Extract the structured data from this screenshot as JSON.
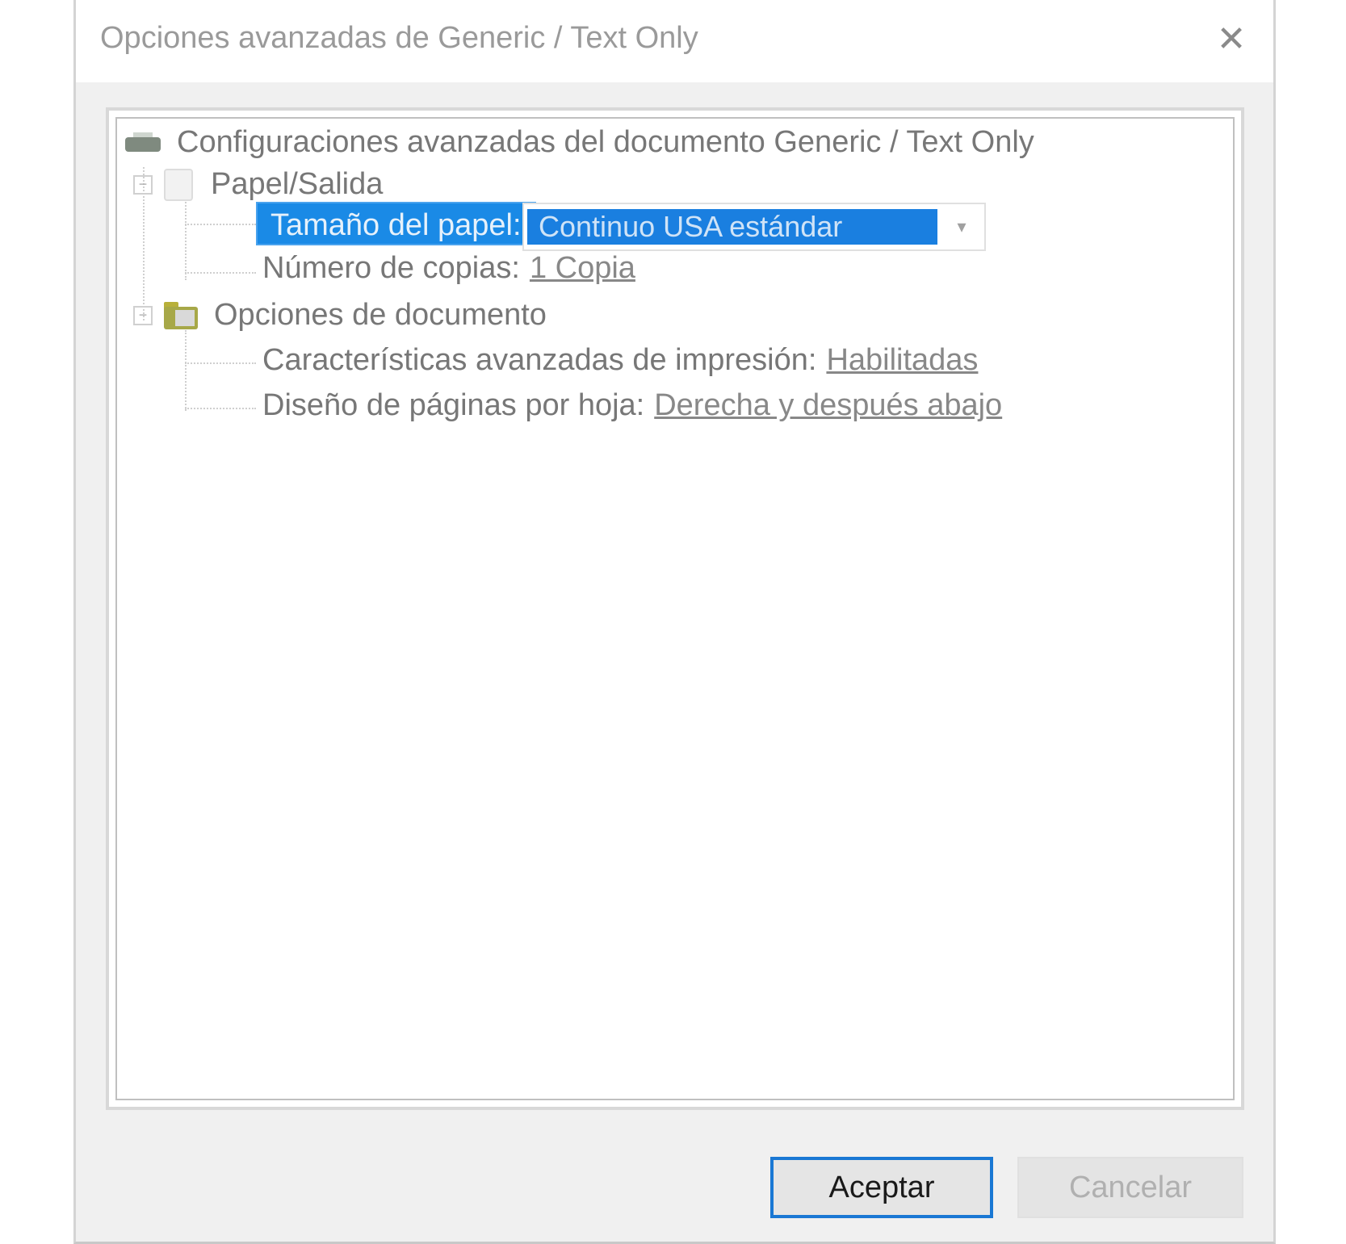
{
  "window": {
    "title": "Opciones avanzadas de Generic / Text Only",
    "close_glyph": "✕"
  },
  "tree": {
    "root_label": "Configuraciones avanzadas del documento Generic / Text Only",
    "paper_output": {
      "label": "Papel/Salida",
      "expander": "−",
      "paper_size": {
        "label": "Tamaño del papel:",
        "value": "Continuo USA estándar"
      },
      "copies": {
        "label": "Número de copias:",
        "value": "1 Copia"
      }
    },
    "document_options": {
      "label": "Opciones de documento",
      "expander": "−",
      "advanced_features": {
        "label": "Características avanzadas de impresión:",
        "value": "Habilitadas"
      },
      "pages_layout": {
        "label": "Diseño de páginas por hoja:",
        "value": "Derecha y después abajo"
      }
    }
  },
  "buttons": {
    "ok": "Aceptar",
    "cancel": "Cancelar"
  },
  "icons": {
    "root": "printer-icon",
    "paper_output": "page-icon",
    "document_options": "folder-icon",
    "combo": "chevron-down-icon",
    "close": "close-icon"
  },
  "colors": {
    "selection": "#1a8ae6",
    "ok_border": "#1a78d4",
    "dialog_bg": "#f0f0f0"
  }
}
